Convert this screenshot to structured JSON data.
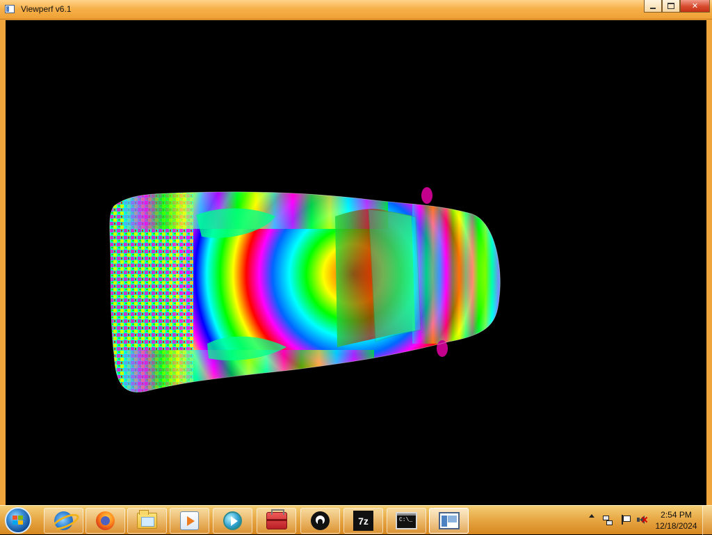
{
  "window": {
    "title": "Viewperf v6.1",
    "controls": {
      "minimize": "—",
      "maximize": "□",
      "close": "✕"
    }
  },
  "scene": {
    "background": "#000000",
    "palette": [
      "#ff00ff",
      "#ff0000",
      "#ffff00",
      "#00ff00",
      "#00ffff",
      "#0000ff"
    ]
  },
  "taskbar": {
    "items": [
      {
        "name": "internet-explorer",
        "icon": "internet-explorer-icon"
      },
      {
        "name": "firefox",
        "icon": "firefox-icon"
      },
      {
        "name": "file-explorer",
        "icon": "folder-icon"
      },
      {
        "name": "media-center",
        "icon": "media-icon"
      },
      {
        "name": "media-player",
        "icon": "player-icon"
      },
      {
        "name": "toolbox",
        "icon": "toolbox-icon"
      },
      {
        "name": "github",
        "icon": "github-icon"
      },
      {
        "name": "seven-zip",
        "icon": "seven-zip-icon",
        "text": "7z"
      },
      {
        "name": "command-prompt",
        "icon": "command-prompt-icon",
        "text": "C:\\_"
      },
      {
        "name": "viewperf",
        "icon": "viewperf-icon"
      }
    ],
    "tray": {
      "time": "2:54 PM",
      "date": "12/18/2024"
    }
  }
}
